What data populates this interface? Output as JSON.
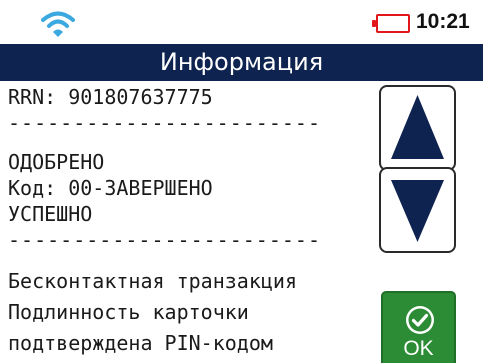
{
  "status": {
    "wifi_icon": "wifi-icon",
    "battery_icon": "battery-empty-icon",
    "battery_color": "#e2171b",
    "time": "10:21"
  },
  "header": {
    "title": "Информация"
  },
  "info": {
    "rrn": "RRN: 901807637775",
    "separator_1": "------------------------",
    "status_line": "ОДОБРЕНО",
    "code_line": "Код: 00-ЗАВЕРШЕНО",
    "result_line": "УСПЕШНО",
    "separator_2": "------------------------",
    "message_1": "Бесконтактная транзакция",
    "message_2": "Подлинность карточки",
    "message_3": "подтверждена PIN-кодом"
  },
  "buttons": {
    "scroll_up_icon": "triangle-up-icon",
    "scroll_down_icon": "triangle-down-icon",
    "ok_icon": "check-circle-icon",
    "ok_label": "OK"
  },
  "colors": {
    "header_bg": "#0f2351",
    "ok_green": "#2c8c35",
    "arrow_blue": "#0f2351"
  }
}
